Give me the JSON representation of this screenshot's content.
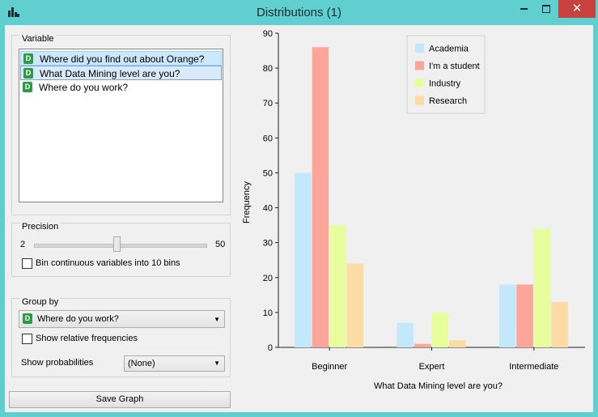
{
  "window": {
    "title": "Distributions (1)",
    "icons": {
      "app": "bar-chart-icon",
      "minimize": "minimize-icon",
      "maximize": "maximize-icon",
      "close": "close-icon"
    }
  },
  "variable_box": {
    "title": "Variable",
    "items": [
      {
        "label": "Where did you find out about Orange?",
        "type_badge": "D"
      },
      {
        "label": "What Data Mining level are you?",
        "type_badge": "D"
      },
      {
        "label": "Where do you work?",
        "type_badge": "D"
      }
    ],
    "selected_index": 1
  },
  "precision_box": {
    "title": "Precision",
    "slider_min": "2",
    "slider_max": "50",
    "slider_fraction": 0.48,
    "bin_checkbox_label": "Bin continuous variables into 10 bins",
    "bin_checked": false
  },
  "group_box": {
    "title": "Group by",
    "group_by_value": "Where do you work?",
    "group_by_badge": "D",
    "relative_label": "Show relative frequencies",
    "relative_checked": false,
    "probabilities_label": "Show probabilities",
    "probabilities_value": "(None)"
  },
  "save_button_label": "Save Graph",
  "chart_data": {
    "type": "bar",
    "categories": [
      "Beginner",
      "Expert",
      "Intermediate"
    ],
    "series": [
      {
        "name": "Academia",
        "color": "#c4e8fb",
        "values": [
          50,
          7,
          18
        ]
      },
      {
        "name": "I'm a student",
        "color": "#fca69a",
        "values": [
          86,
          1,
          18
        ]
      },
      {
        "name": "Industry",
        "color": "#e8fd9b",
        "values": [
          35,
          10,
          34
        ]
      },
      {
        "name": "Research",
        "color": "#fddba4",
        "values": [
          24,
          2,
          13
        ]
      }
    ],
    "xlabel": "What Data Mining level are you?",
    "ylabel": "Frequency",
    "ylim": [
      0,
      90
    ],
    "yticks": [
      "0",
      "10",
      "20",
      "30",
      "40",
      "50",
      "60",
      "70",
      "80",
      "90"
    ],
    "legend_position": "top-right",
    "grid": false
  }
}
